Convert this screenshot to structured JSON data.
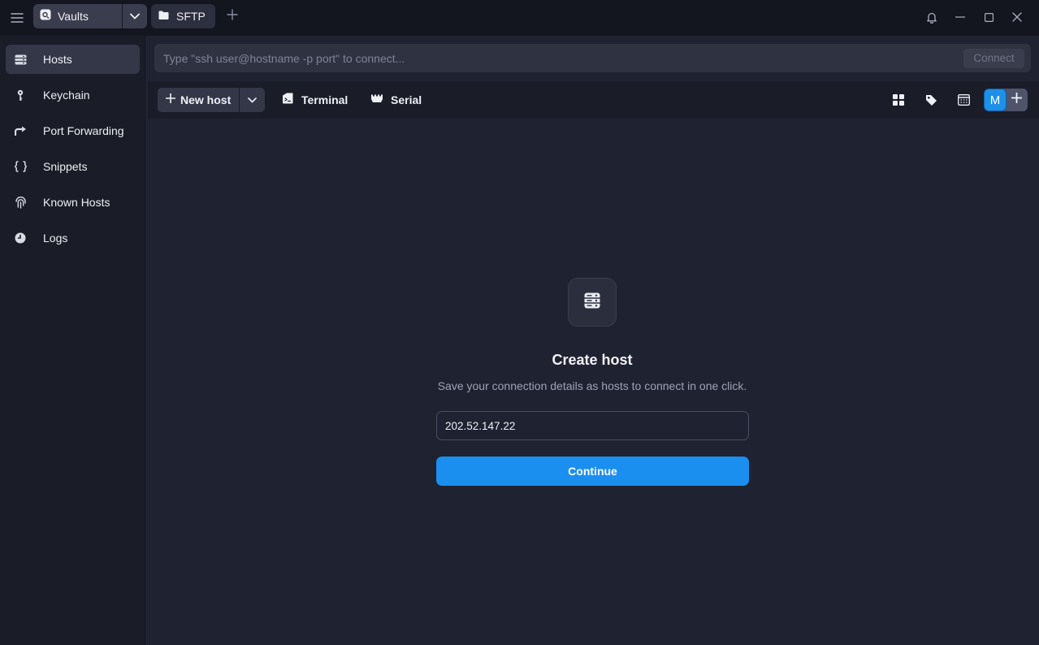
{
  "titlebar": {
    "vault_label": "Vaults",
    "sftp_label": "SFTP"
  },
  "sidebar": {
    "items": [
      {
        "label": "Hosts",
        "icon": "hosts-icon",
        "active": true
      },
      {
        "label": "Keychain",
        "icon": "key-icon",
        "active": false
      },
      {
        "label": "Port Forwarding",
        "icon": "port-forward-icon",
        "active": false
      },
      {
        "label": "Snippets",
        "icon": "braces-icon",
        "active": false
      },
      {
        "label": "Known Hosts",
        "icon": "fingerprint-icon",
        "active": false
      },
      {
        "label": "Logs",
        "icon": "clock-icon",
        "active": false
      }
    ]
  },
  "connect": {
    "placeholder": "Type \"ssh user@hostname -p port\" to connect...",
    "button_label": "Connect"
  },
  "toolbar": {
    "new_host_label": "New host",
    "terminal_label": "Terminal",
    "serial_label": "Serial",
    "avatar_initial": "M"
  },
  "empty_state": {
    "title": "Create host",
    "subtitle": "Save your connection details as hosts to connect in one click.",
    "address_value": "202.52.147.22",
    "continue_label": "Continue"
  },
  "colors": {
    "accent": "#1b8ff0",
    "background": "#1f2231",
    "sidebar": "#1a1c27"
  }
}
